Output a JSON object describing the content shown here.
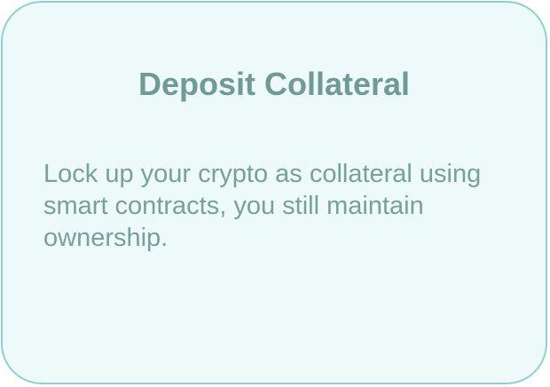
{
  "card": {
    "title": "Deposit Collateral",
    "body": "Lock up your crypto as collateral using smart contracts, you still maintain ownership."
  },
  "colors": {
    "card_background": "#eef9fa",
    "card_border": "#8fd0cf",
    "title_text": "#6f9a96",
    "body_text": "#78a09c"
  }
}
